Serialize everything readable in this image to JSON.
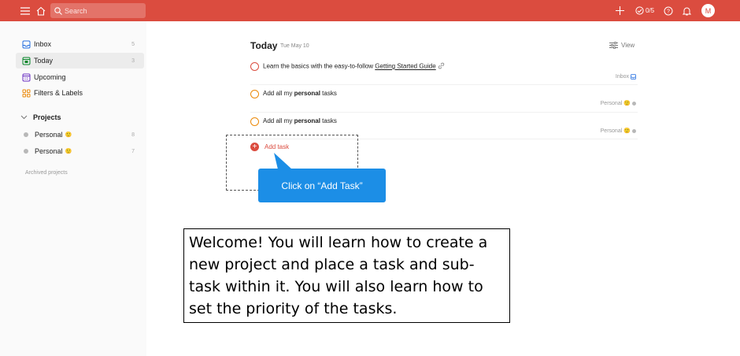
{
  "topbar": {
    "search_placeholder": "Search",
    "karma_text": "0/5",
    "avatar_initial": "M",
    "icons": [
      "menu-icon",
      "home-icon",
      "search-icon",
      "add-icon",
      "productivity-icon",
      "help-icon",
      "bell-icon"
    ],
    "accent": "#db4c3f"
  },
  "sidebar": {
    "items": [
      {
        "label": "Inbox",
        "count": "5",
        "icon": "inbox-icon",
        "color": "#246fe0"
      },
      {
        "label": "Today",
        "count": "3",
        "icon": "calendar-today-icon",
        "color": "#058527"
      },
      {
        "label": "Upcoming",
        "count": "",
        "icon": "calendar-upcoming-icon",
        "color": "#692fc2"
      },
      {
        "label": "Filters & Labels",
        "count": "",
        "icon": "filters-icon",
        "color": "#eb8909"
      }
    ],
    "projects_heading": "Projects",
    "projects": [
      {
        "label": "Personal",
        "emoji": "🙂",
        "count": "8"
      },
      {
        "label": "Personal",
        "emoji": "🙂",
        "count": "7"
      }
    ],
    "archived_label": "Archived projects"
  },
  "main": {
    "title": "Today",
    "date": "Tue May 10",
    "view_label": "View",
    "tasks": [
      {
        "text_before": "Learn the basics with the easy-to-follow ",
        "link": "Getting Started Guide",
        "meta": "Inbox",
        "priority_color": "#db4c3f"
      },
      {
        "text_before": "Add all my ",
        "bold": "personal",
        "text_after": " tasks",
        "meta": "Personal",
        "meta_emoji": "🙂",
        "priority_color": "#eb8909"
      },
      {
        "text_before": "Add all my ",
        "bold": "personal",
        "text_after": " tasks",
        "meta": "Personal",
        "meta_emoji": "🙂",
        "priority_color": "#eb8909"
      }
    ],
    "add_task_label": "Add task"
  },
  "tutorial": {
    "callout": "Click on “Add Task”",
    "callout_color": "#1c8ee6",
    "welcome": "Welcome! You will learn how to create a new project and place a task and sub-task within it. You will also learn how to set the priority of the tasks."
  }
}
